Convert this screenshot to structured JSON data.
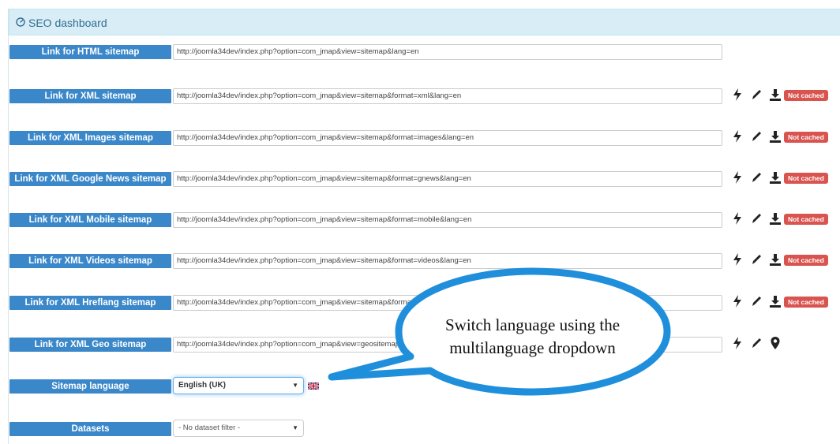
{
  "header": {
    "title": "SEO dashboard",
    "icon": "dashboard-icon"
  },
  "rows": [
    {
      "label": "Link for HTML sitemap",
      "url": "http://joomla34dev/index.php?option=com_jmap&view=sitemap&lang=en",
      "actions": [],
      "badge": ""
    },
    {
      "label": "Link for XML sitemap",
      "url": "http://joomla34dev/index.php?option=com_jmap&view=sitemap&format=xml&lang=en",
      "actions": [
        "bolt-icon",
        "pencil-icon",
        "download-icon"
      ],
      "badge": "Not cached"
    },
    {
      "label": "Link for XML Images sitemap",
      "url": "http://joomla34dev/index.php?option=com_jmap&view=sitemap&format=images&lang=en",
      "actions": [
        "bolt-icon",
        "pencil-icon",
        "download-icon"
      ],
      "badge": "Not cached"
    },
    {
      "label": "Link for XML Google News sitemap",
      "url": "http://joomla34dev/index.php?option=com_jmap&view=sitemap&format=gnews&lang=en",
      "actions": [
        "bolt-icon",
        "pencil-icon",
        "download-icon"
      ],
      "badge": "Not cached"
    },
    {
      "label": "Link for XML Mobile sitemap",
      "url": "http://joomla34dev/index.php?option=com_jmap&view=sitemap&format=mobile&lang=en",
      "actions": [
        "bolt-icon",
        "pencil-icon",
        "download-icon"
      ],
      "badge": "Not cached"
    },
    {
      "label": "Link for XML Videos sitemap",
      "url": "http://joomla34dev/index.php?option=com_jmap&view=sitemap&format=videos&lang=en",
      "actions": [
        "bolt-icon",
        "pencil-icon",
        "download-icon"
      ],
      "badge": "Not cached"
    },
    {
      "label": "Link for XML Hreflang sitemap",
      "url": "http://joomla34dev/index.php?option=com_jmap&view=sitemap&format=hreflang&lang=en",
      "actions": [
        "bolt-icon",
        "pencil-icon",
        "download-icon"
      ],
      "badge": "Not cached"
    },
    {
      "label": "Link for XML Geo sitemap",
      "url": "http://joomla34dev/index.php?option=com_jmap&view=geositemap&format=xml&lang=en",
      "actions": [
        "bolt-icon",
        "pencil-icon",
        "map-marker-icon"
      ],
      "badge": ""
    }
  ],
  "language": {
    "label": "Sitemap language",
    "selected": "English (UK)",
    "flag": "uk-flag-icon"
  },
  "datasets": {
    "label": "Datasets",
    "selected": "- No dataset filter -"
  },
  "callout": {
    "line1": "Switch language using the",
    "line2": "multilanguage dropdown"
  },
  "colors": {
    "accent": "#3a87c9",
    "badge": "#d9534f",
    "header_bg": "#d9edf7",
    "header_text": "#31708f",
    "callout_stroke": "#1f8fdc"
  }
}
